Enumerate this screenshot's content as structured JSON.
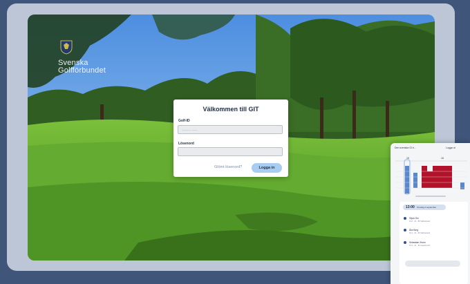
{
  "brand": {
    "logo_line1": "Svenska",
    "logo_line2": "Golfförbundet",
    "crest_icon": "shield-crest-icon"
  },
  "login": {
    "title": "Välkommen till GIT",
    "golf_id_label": "Golf-ID",
    "golf_id_placeholder": "———- ——",
    "password_label": "Lösenord",
    "password_value": "",
    "forgot_link": "Glömt lösenord?",
    "login_button": "Logga in"
  },
  "phone": {
    "course_select": "Den svenska GI b...",
    "logout_label": "Logga ut",
    "hours": [
      "15",
      "16"
    ],
    "time_label": "13:00",
    "date_label": "Torsdag 2 september",
    "players": [
      {
        "name": "Örjan Örn",
        "hcp": "10,6 · ÅL · 80 Valbostrand"
      },
      {
        "name": "Åke Berg",
        "hcp": "19,1 · ÅL · 80 Valbostrand"
      },
      {
        "name": "Sebastian Zevon",
        "hcp": "15,3 · ÅL · 82 Augusta GK"
      }
    ]
  },
  "colors": {
    "page_bg": "#3f5579",
    "tablet_frame": "#bcc6d6",
    "booked_red": "#b3132a",
    "accent_blue": "#a9cdf0"
  }
}
